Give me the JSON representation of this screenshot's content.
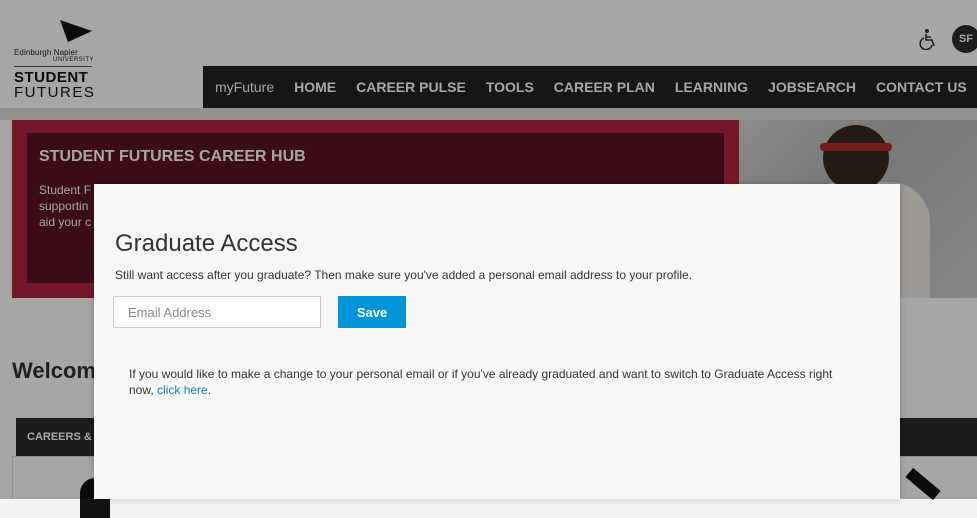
{
  "header": {
    "logo": {
      "university_line1": "Edinburgh Napier",
      "university_line2": "UNIVERSITY",
      "brand_line1": "STUDENT",
      "brand_line2": "FUTURES"
    },
    "avatar_initials": "SF",
    "nav": [
      "myFuture",
      "HOME",
      "CAREER PULSE",
      "TOOLS",
      "CAREER PLAN",
      "LEARNING",
      "JOBSEARCH",
      "CONTACT US"
    ]
  },
  "hero": {
    "title": "STUDENT FUTURES CAREER HUB",
    "lines": [
      "Student F",
      "supportin",
      "aid your c"
    ]
  },
  "welcome": "Welcom",
  "cards": {
    "section_label": "CAREERS &"
  },
  "modal": {
    "title": "Graduate Access",
    "description": "Still want access after you graduate? Then make sure you've added a personal email address to your profile.",
    "email_placeholder": "Email Address",
    "save_label": "Save",
    "note_text": "If you would like to make a change to your personal email or if you've already graduated and want to switch to Graduate Access right now,",
    "note_link": "click here",
    "note_end": "."
  },
  "colors": {
    "nav_bg": "#232323",
    "hero_accent": "#b5233f",
    "hero_dark": "#5b1322",
    "save_button": "#0094d9",
    "link": "#1a7cc1"
  }
}
